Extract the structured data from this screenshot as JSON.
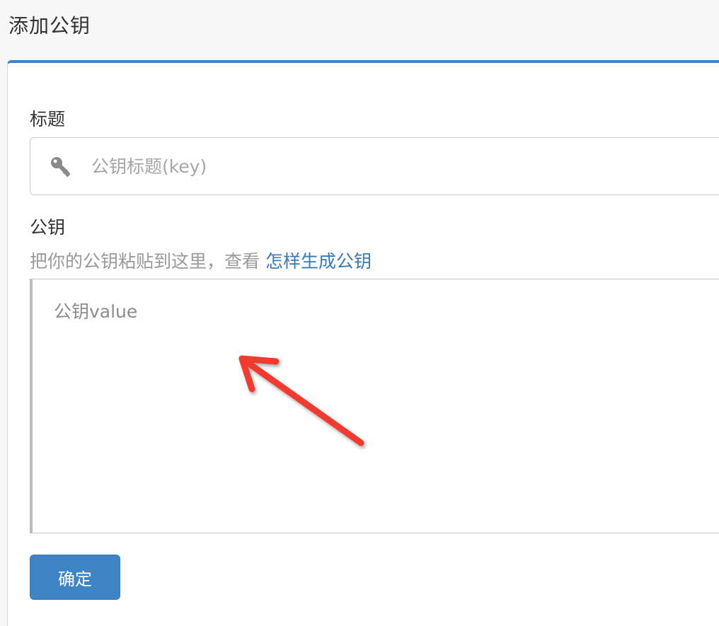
{
  "page": {
    "title": "添加公钥"
  },
  "form": {
    "title_label": "标题",
    "title_placeholder": "公钥标题(key)",
    "title_value": "",
    "key_label": "公钥",
    "hint_text": "把你的公钥粘贴到这里，查看 ",
    "hint_link": "怎样生成公钥",
    "key_placeholder": "公钥value",
    "key_value": "",
    "submit_label": "确定"
  },
  "icons": {
    "title_input_icon": "key-icon",
    "annotation": "red-arrow"
  },
  "colors": {
    "accent": "#3f85c6",
    "link": "#3a7ab8",
    "annotation_arrow": "#f23a2e"
  }
}
